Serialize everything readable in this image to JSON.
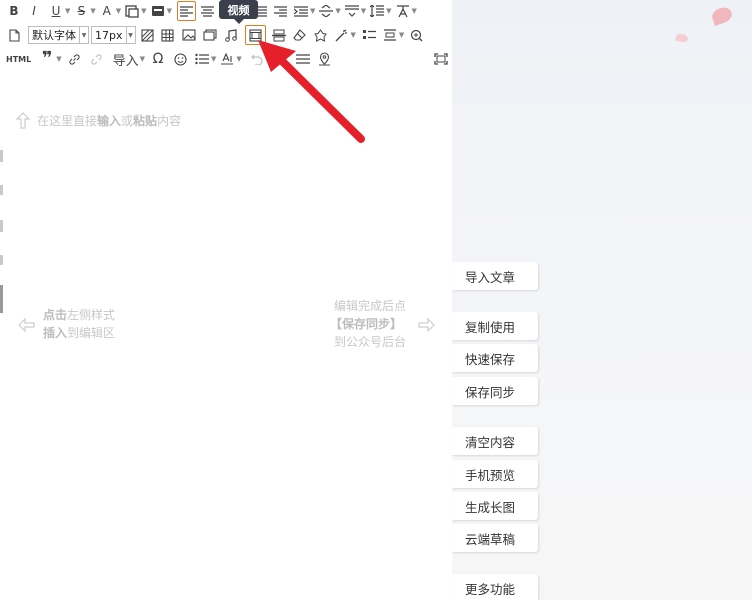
{
  "toolbar": {
    "font_family": "默认字体",
    "font_size": "17px",
    "html_label": "HTML",
    "import_label": "导入",
    "video_tooltip": "视频"
  },
  "hints": {
    "paste_normal": "在这里直接",
    "paste_bold1": "输入",
    "paste_mid": "或",
    "paste_bold2": "粘贴",
    "paste_end": "内容",
    "click_bold": "点击",
    "click_rest": "左侧样式",
    "insert_bold": "插入",
    "insert_rest": "到编辑区",
    "sync_line1": "编辑完成后点",
    "sync_line2": "【保存同步】",
    "sync_line3": "到公众号后台"
  },
  "side_buttons": [
    "导入文章",
    "复制使用",
    "快速保存",
    "保存同步",
    "清空内容",
    "手机预览",
    "生成长图",
    "云端草稿",
    "更多功能"
  ],
  "colors": {
    "accent_orange": "#e07b24",
    "arrow_red": "#e5202b",
    "tooltip_bg": "#3a3f4b"
  }
}
